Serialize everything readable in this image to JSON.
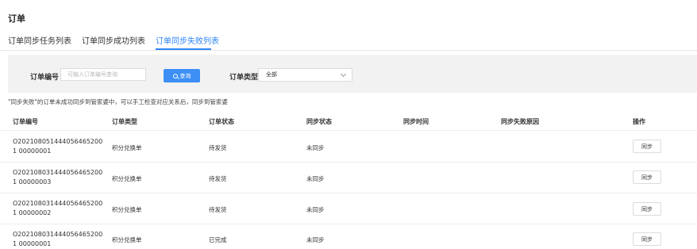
{
  "page": {
    "title": "订单"
  },
  "tabs": [
    {
      "label": "订单同步任务列表",
      "active": false
    },
    {
      "label": "订单同步成功列表",
      "active": false
    },
    {
      "label": "订单同步失败列表",
      "active": true
    }
  ],
  "filter": {
    "order_no_label": "订单编号",
    "order_no_placeholder": "可输入订单编号查询",
    "order_no_value": "",
    "query_button": "查询",
    "order_type_label": "订单类型",
    "order_type_selected": "全部"
  },
  "notice": "\"同步失败\"的订单未成功同步到管家婆中，可以手工检查对应关系后，同步到管家婆",
  "table": {
    "columns": [
      "订单编号",
      "订单类型",
      "订单状态",
      "同步状态",
      "同步时间",
      "同步失败原因",
      "操作"
    ],
    "rows": [
      {
        "id": "O2021080514440564652001 00000001",
        "type": "积分兑换单",
        "status": "待发货",
        "sync_status": "未同步",
        "sync_time": "",
        "fail_reason": "",
        "action": "同步"
      },
      {
        "id": "O2021080314440564652001 00000003",
        "type": "积分兑换单",
        "status": "待发货",
        "sync_status": "未同步",
        "sync_time": "",
        "fail_reason": "",
        "action": "同步"
      },
      {
        "id": "O2021080314440564652001 00000002",
        "type": "积分兑换单",
        "status": "待发货",
        "sync_status": "未同步",
        "sync_time": "",
        "fail_reason": "",
        "action": "同步"
      },
      {
        "id": "O2021080314440564652001 00000001",
        "type": "积分兑换单",
        "status": "已完成",
        "sync_status": "未同步",
        "sync_time": "",
        "fail_reason": "",
        "action": "同步"
      }
    ]
  },
  "colors": {
    "accent": "#2f86f6",
    "button": "#3d8ff5",
    "filter_bg": "#f2f2f2"
  }
}
